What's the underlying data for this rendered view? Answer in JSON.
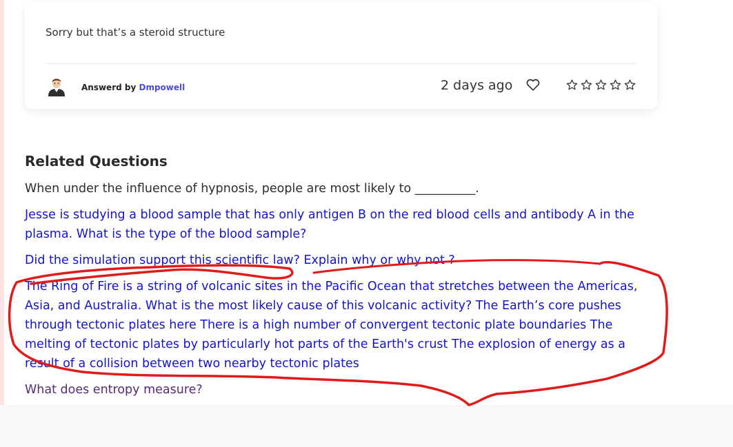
{
  "answer": {
    "text": "Sorry but that’s a steroid structure",
    "answered_by_label": "Answerd by",
    "answerer_name": "Dmpowell",
    "time_ago": "2 days ago",
    "rating_stars": 0,
    "rating_max": 5,
    "icons": [
      "avatar",
      "heart-icon",
      "star-icon"
    ]
  },
  "related": {
    "heading": "Related Questions",
    "questions": [
      {
        "text": "When under the influence of hypnosis, people are most likely to __________."
      },
      {
        "text": "Jesse is studying a blood sample that has only antigen B on the red blood cells and antibody A in the plasma. What is the type of the blood sample?"
      },
      {
        "text": "Did the simulation support this scientific law? Explain why or why not ?"
      },
      {
        "text": "The Ring of Fire is a string of volcanic sites in the Pacific Ocean that stretches between the Americas, Asia, and Australia. What is the most likely cause of this volcanic activity? The Earth’s core pushes through tectonic plates here There is a high number of convergent tectonic plate boundaries The melting of tectonic plates by particularly hot parts of the Earth's crust The explosion of energy as a result of a collision between two nearby tectonic plates"
      },
      {
        "text": "What does entropy measure?"
      }
    ]
  },
  "colors": {
    "link": "#1414c8",
    "visited_link": "#552a7a",
    "answerer": "#4b4bdb",
    "annotation": "#e01b1b"
  }
}
